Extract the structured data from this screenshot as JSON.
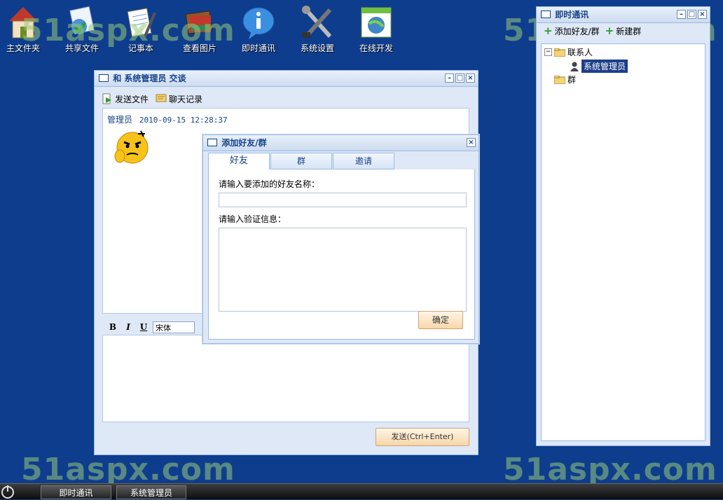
{
  "desktop": {
    "icons": [
      {
        "name": "home-folder-icon",
        "label": "主文件夹"
      },
      {
        "name": "shared-files-icon",
        "label": "共享文件"
      },
      {
        "name": "notepad-icon",
        "label": "记事本"
      },
      {
        "name": "image-viewer-icon",
        "label": "查看图片"
      },
      {
        "name": "info-icon",
        "label": "即时通讯"
      },
      {
        "name": "tools-icon",
        "label": "系统设置"
      },
      {
        "name": "online-dev-icon",
        "label": "在线开发"
      }
    ],
    "watermark": "51aspx.com"
  },
  "chat_window": {
    "title": "和 系统管理员 交谈",
    "toolbar": {
      "send_file": "发送文件",
      "chat_history": "聊天记录"
    },
    "message": {
      "sender": "管理员",
      "time": "2010-09-15 12:28:37"
    },
    "format": {
      "bold": "B",
      "italic": "I",
      "underline": "U",
      "font": "宋体"
    },
    "send_label": "发送(Ctrl+Enter)"
  },
  "add_dialog": {
    "title": "添加好友/群",
    "tabs": [
      "好友",
      "群",
      "邀请"
    ],
    "friend_name_label": "请输入要添加的好友名称：",
    "verify_label": "请输入验证信息：",
    "ok_label": "确定"
  },
  "im_panel": {
    "title": "即时通讯",
    "add_label": "添加好友/群",
    "new_group_label": "新建群",
    "tree": {
      "contacts": "联系人",
      "admin": "系统管理员",
      "groups": "群"
    }
  },
  "taskbar": {
    "tasks": [
      "即时通讯",
      "系统管理员"
    ]
  },
  "colors": {
    "desktop": "#0e3d8e",
    "title_text": "#15428b",
    "accent": "#99bbe8"
  }
}
